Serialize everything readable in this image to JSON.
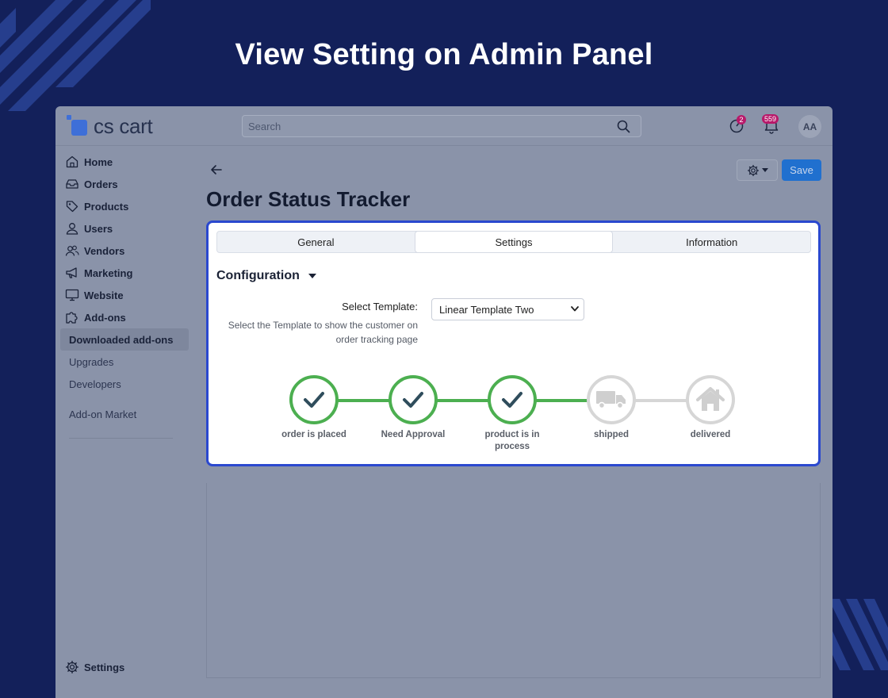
{
  "page_heading": "View Setting on Admin Panel",
  "app": {
    "logo_text": "cs cart",
    "search": {
      "placeholder": "Search"
    },
    "badges": {
      "alerts": "2",
      "notifications": "559"
    },
    "avatar": "AA",
    "accent_color": "#2070cf"
  },
  "sidebar": {
    "items": [
      {
        "label": "Home",
        "icon": "home-icon"
      },
      {
        "label": "Orders",
        "icon": "inbox-icon"
      },
      {
        "label": "Products",
        "icon": "tag-icon"
      },
      {
        "label": "Users",
        "icon": "user-icon"
      },
      {
        "label": "Vendors",
        "icon": "users-icon"
      },
      {
        "label": "Marketing",
        "icon": "megaphone-icon"
      },
      {
        "label": "Website",
        "icon": "monitor-icon"
      },
      {
        "label": "Add-ons",
        "icon": "puzzle-icon"
      }
    ],
    "sub_items": [
      {
        "label": "Downloaded add-ons",
        "active": true
      },
      {
        "label": "Upgrades"
      },
      {
        "label": "Developers"
      },
      {
        "label": "Add-on Market"
      }
    ],
    "footer": {
      "label": "Settings",
      "icon": "gear-icon"
    }
  },
  "main": {
    "title": "Order Status Tracker",
    "save_label": "Save"
  },
  "card": {
    "tabs": [
      {
        "label": "General"
      },
      {
        "label": "Settings",
        "active": true
      },
      {
        "label": "Information"
      }
    ],
    "section_title": "Configuration",
    "field": {
      "label": "Select Template:",
      "help": "Select the Template to show the customer on order tracking page",
      "value": "Linear Template Two"
    },
    "steps": [
      {
        "label": "order is placed",
        "state": "done",
        "icon": "check-icon"
      },
      {
        "label": "Need Approval",
        "state": "done",
        "icon": "check-icon"
      },
      {
        "label": "product is in process",
        "state": "done",
        "icon": "check-icon"
      },
      {
        "label": "shipped",
        "state": "pending",
        "icon": "truck-icon"
      },
      {
        "label": "delivered",
        "state": "pending",
        "icon": "house-icon"
      }
    ],
    "colors": {
      "done": "#4caf50",
      "pending": "#d6d6d6",
      "border": "#2a48cf"
    }
  }
}
